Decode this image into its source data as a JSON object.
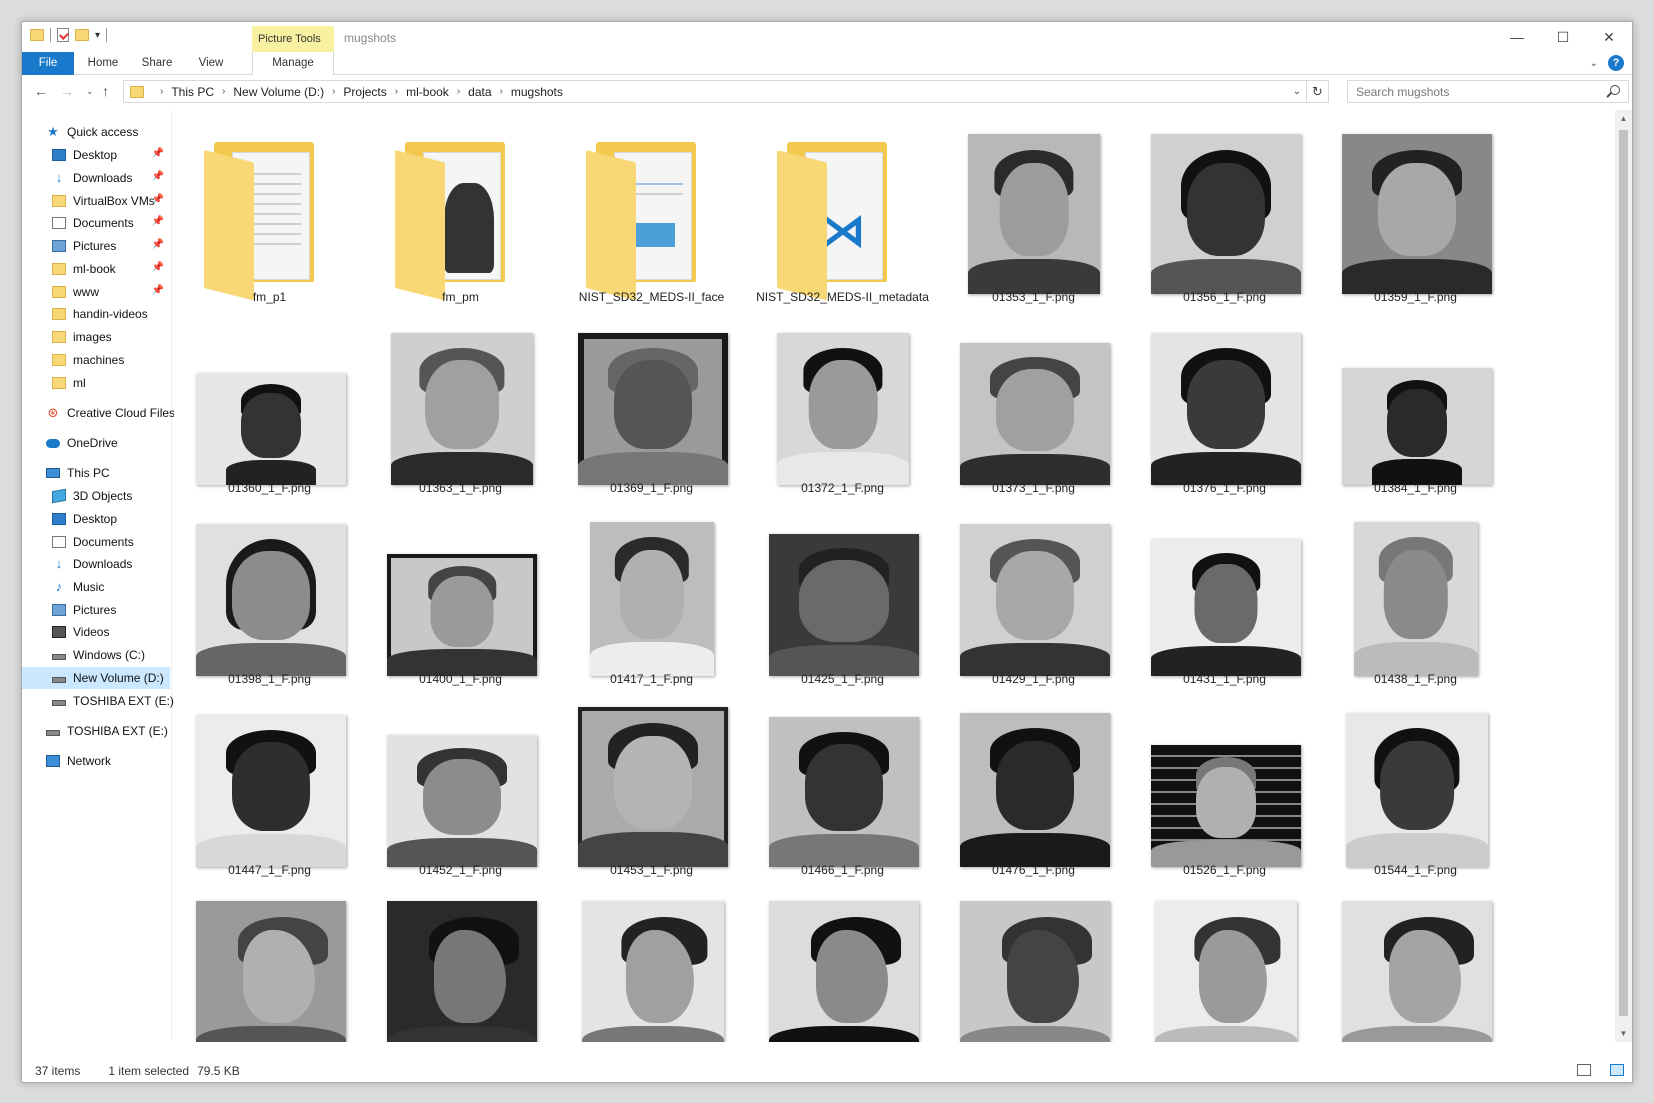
{
  "window": {
    "title": "mugshots",
    "contextual_group": "Picture Tools",
    "controls": {
      "minimize": "—",
      "maximize": "☐",
      "close": "✕"
    }
  },
  "ribbon": {
    "tabs": [
      "File",
      "Home",
      "Share",
      "View",
      "Manage"
    ]
  },
  "address": {
    "path": [
      "This PC",
      "New Volume (D:)",
      "Projects",
      "ml-book",
      "data",
      "mugshots"
    ],
    "search_placeholder": "Search mugshots"
  },
  "nav": {
    "quick_access": "Quick access",
    "quick_items": [
      "Desktop",
      "Downloads",
      "VirtualBox VMs",
      "Documents",
      "Pictures",
      "ml-book",
      "www",
      "handin-videos",
      "images",
      "machines",
      "ml"
    ],
    "creative_cloud": "Creative Cloud Files",
    "onedrive": "OneDrive",
    "this_pc": "This PC",
    "pc_items": [
      "3D Objects",
      "Desktop",
      "Documents",
      "Downloads",
      "Music",
      "Pictures",
      "Videos",
      "Windows (C:)",
      "New Volume (D:)",
      "TOSHIBA EXT (E:)"
    ],
    "toshiba": "TOSHIBA EXT (E:)",
    "network": "Network"
  },
  "files": [
    "fm_p1",
    "fm_pm",
    "NIST_SD32_MEDS-II_face",
    "NIST_SD32_MEDS-II_metadata",
    "01353_1_F.png",
    "01356_1_F.png",
    "01359_1_F.png",
    "01360_1_F.png",
    "01363_1_F.png",
    "01369_1_F.png",
    "01372_1_F.png",
    "01373_1_F.png",
    "01376_1_F.png",
    "01384_1_F.png",
    "01398_1_F.png",
    "01400_1_F.png",
    "01417_1_F.png",
    "01425_1_F.png",
    "01429_1_F.png",
    "01431_1_F.png",
    "01438_1_F.png",
    "01447_1_F.png",
    "01452_1_F.png",
    "01453_1_F.png",
    "01466_1_F.png",
    "01476_1_F.png",
    "01526_1_F.png",
    "01544_1_F.png"
  ],
  "status": {
    "item_count": "37 items",
    "selection": "1 item selected",
    "size": "79.5 KB"
  }
}
